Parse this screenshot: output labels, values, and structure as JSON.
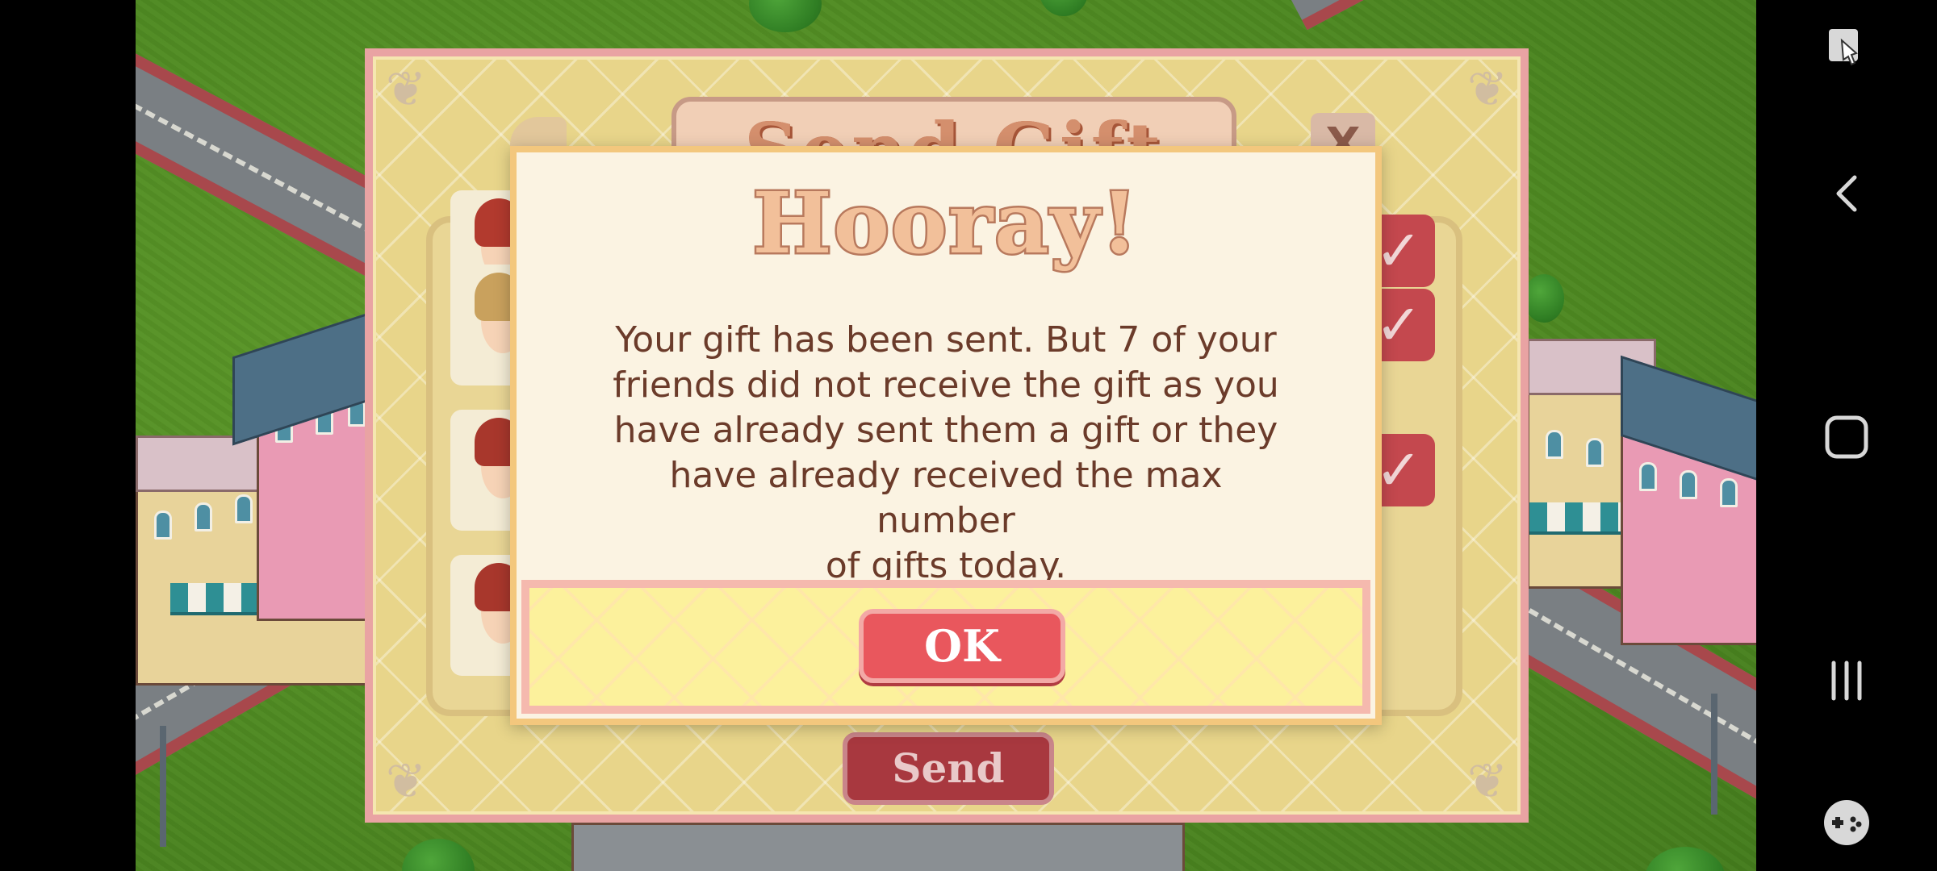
{
  "gift_dialog": {
    "title": "Send Gift",
    "close_label": "X",
    "send_label": "Send"
  },
  "hooray_dialog": {
    "title": "Hooray!",
    "message_lines": [
      "Your gift has been sent. But 7 of your",
      "friends did not receive the gift as you",
      "have already sent them a gift or they",
      "have already received the max number",
      "of gifts today."
    ],
    "ok_label": "OK"
  },
  "navbar": {
    "icons": [
      "screen-capture-icon",
      "back-icon",
      "home-icon",
      "recent-apps-icon",
      "game-controller-icon"
    ]
  },
  "colors": {
    "grass": "#4f8a22",
    "panel_yellow": "#e8d58a",
    "dialog_bg": "#fbf3e2",
    "ok_button": "#e9575d",
    "text_brown": "#6b3b2a"
  }
}
